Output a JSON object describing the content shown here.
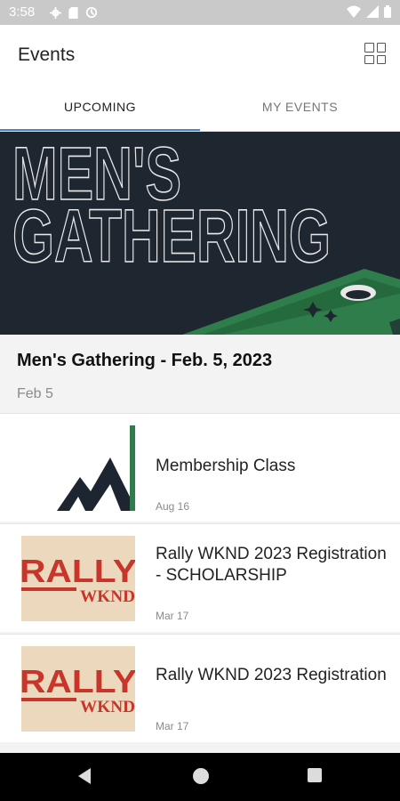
{
  "status_bar": {
    "time": "3:58"
  },
  "app_bar": {
    "title": "Events"
  },
  "tabs": [
    {
      "label": "UPCOMING",
      "active": true
    },
    {
      "label": "MY EVENTS",
      "active": false
    }
  ],
  "hero": {
    "line1": "MEN'S",
    "line2": "GATHERING"
  },
  "featured_event": {
    "title": "Men's Gathering - Feb. 5, 2023",
    "date": "Feb 5"
  },
  "events": [
    {
      "name": "Membership Class",
      "date": "Aug 16",
      "thumb": "mountain-logo"
    },
    {
      "name": "Rally WKND 2023 Registration - SCHOLARSHIP",
      "date": "Mar 17",
      "thumb": "rally-wknd"
    },
    {
      "name": "Rally WKND 2023 Registration",
      "date": "Mar 17",
      "thumb": "rally-wknd"
    }
  ],
  "thumb_text": {
    "rally": "RALLY",
    "wknd": "WKND"
  },
  "colors": {
    "accent": "#4b82c3",
    "hero_bg": "#1e2730",
    "hero_green": "#2e7d4a",
    "rally_red": "#c8352b",
    "rally_bg": "#ecd9bd"
  }
}
